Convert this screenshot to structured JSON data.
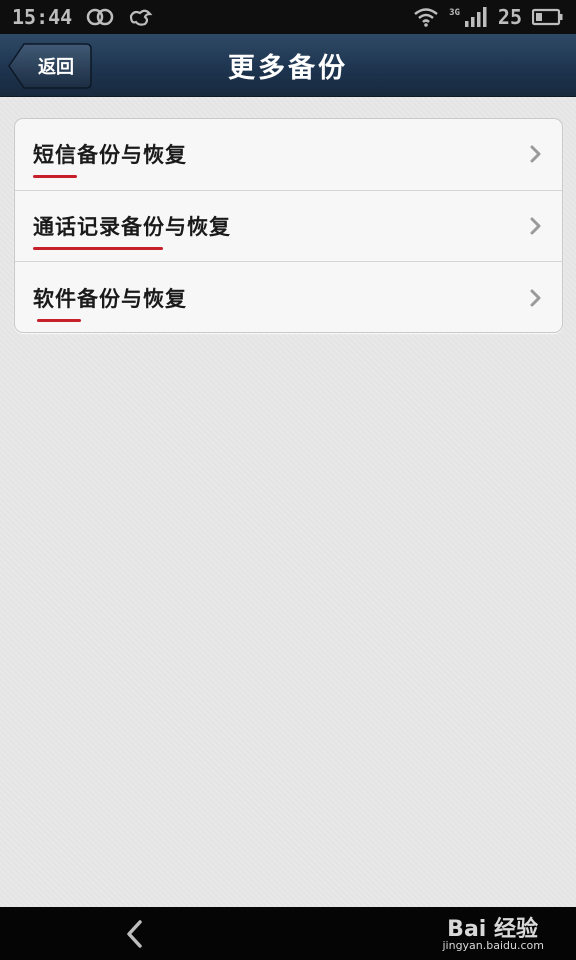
{
  "status_bar": {
    "time": "15:44",
    "network_type": "3G",
    "battery_level": "25",
    "icons": [
      "link-icon",
      "cloud-icon",
      "wifi-icon",
      "signal-icon",
      "battery-icon"
    ]
  },
  "nav": {
    "back_label": "返回",
    "title": "更多备份"
  },
  "list": {
    "items": [
      {
        "label": "短信备份与恢复",
        "icon": "chevron-right-icon"
      },
      {
        "label": "通话记录备份与恢复",
        "icon": "chevron-right-icon"
      },
      {
        "label": "软件备份与恢复",
        "icon": "chevron-right-icon"
      }
    ]
  },
  "bottom_bar": {
    "back_icon": "back-arrow-icon"
  },
  "watermark": {
    "logo_text": "Bai 经验",
    "url": "jingyan.baidu.com"
  },
  "colors": {
    "nav_background": "#1e3550",
    "annotation_underline": "#c8202a",
    "status_bar": "#0e0e0e"
  }
}
